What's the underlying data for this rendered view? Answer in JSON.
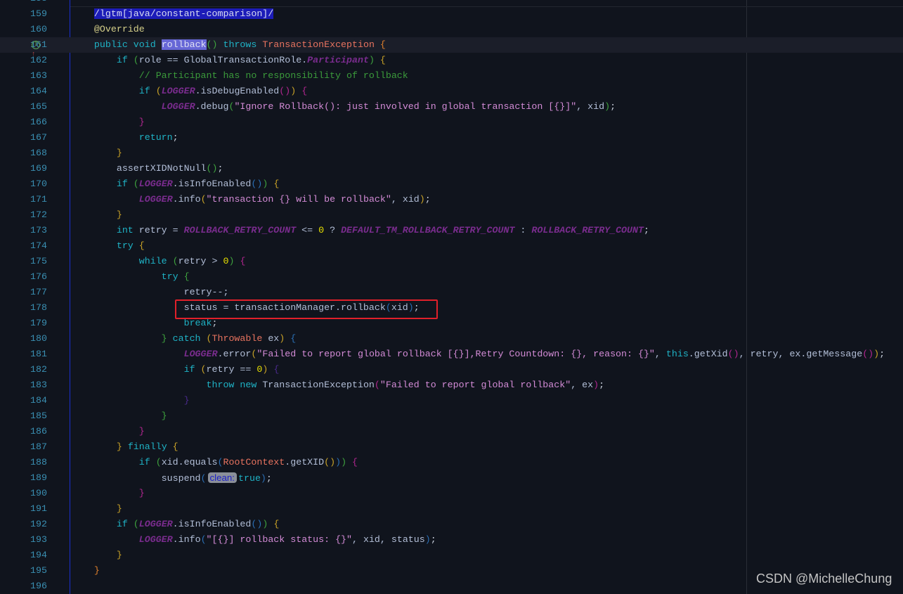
{
  "editor": {
    "first_line_number": 158,
    "current_line": 161,
    "gutter_icon_line": 161,
    "gutter_icon": "implements-override-icon",
    "highlighted_line_box": 178,
    "colors": {
      "background": "#10141d",
      "line_numbers": "#3a8fb2",
      "highlight_box": "#e0202a",
      "keyword": "#1fb3c6",
      "string": "#d38bd6",
      "comment": "#3b9b3b",
      "constant": "#7a2c8e",
      "class": "#e8735f"
    },
    "lines": [
      [],
      [
        [
          "p",
          "    "
        ],
        [
          "sel",
          "/lgtm[java/constant-comparison]/"
        ]
      ],
      [
        [
          "p",
          "    "
        ],
        [
          "a",
          "@Override"
        ]
      ],
      [
        [
          "p",
          "    "
        ],
        [
          "k",
          "public void "
        ],
        [
          "hl",
          "rollback"
        ],
        [
          "bg",
          "()"
        ],
        [
          "p",
          " "
        ],
        [
          "k",
          "throws "
        ],
        [
          "C",
          "TransactionException "
        ],
        [
          "bo",
          "{"
        ]
      ],
      [
        [
          "p",
          "        "
        ],
        [
          "k",
          "if "
        ],
        [
          "bg",
          "("
        ],
        [
          "i",
          "role == GlobalTransactionRole."
        ],
        [
          "K",
          "Participant"
        ],
        [
          "bg",
          ")"
        ],
        [
          "p",
          " "
        ],
        [
          "by",
          "{"
        ]
      ],
      [
        [
          "c",
          "            // Participant has no responsibility of rollback"
        ]
      ],
      [
        [
          "p",
          "            "
        ],
        [
          "k",
          "if "
        ],
        [
          "by",
          "("
        ],
        [
          "K",
          "LOGGER"
        ],
        [
          "i",
          ".isDebugEnabled"
        ],
        [
          "bm",
          "()"
        ],
        [
          "by",
          ")"
        ],
        [
          "p",
          " "
        ],
        [
          "bm",
          "{"
        ]
      ],
      [
        [
          "p",
          "                "
        ],
        [
          "K",
          "LOGGER"
        ],
        [
          "i",
          ".debug"
        ],
        [
          "bg",
          "("
        ],
        [
          "s",
          "\"Ignore Rollback(): just involved in global transaction [{}]\""
        ],
        [
          "i",
          ", xid"
        ],
        [
          "bg",
          ")"
        ],
        [
          "p",
          ";"
        ]
      ],
      [
        [
          "p",
          "            "
        ],
        [
          "bm",
          "}"
        ]
      ],
      [
        [
          "p",
          "            "
        ],
        [
          "k",
          "return"
        ],
        [
          "p",
          ";"
        ]
      ],
      [
        [
          "p",
          "        "
        ],
        [
          "by",
          "}"
        ]
      ],
      [
        [
          "p",
          "        "
        ],
        [
          "i",
          "assertXIDNotNull"
        ],
        [
          "bg",
          "()"
        ],
        [
          "p",
          ";"
        ]
      ],
      [
        [
          "p",
          "        "
        ],
        [
          "k",
          "if "
        ],
        [
          "bg",
          "("
        ],
        [
          "K",
          "LOGGER"
        ],
        [
          "i",
          ".isInfoEnabled"
        ],
        [
          "bb",
          "()"
        ],
        [
          "bg",
          ")"
        ],
        [
          "p",
          " "
        ],
        [
          "by",
          "{"
        ]
      ],
      [
        [
          "p",
          "            "
        ],
        [
          "K",
          "LOGGER"
        ],
        [
          "i",
          ".info"
        ],
        [
          "by",
          "("
        ],
        [
          "s",
          "\"transaction {} will be rollback\""
        ],
        [
          "i",
          ", xid"
        ],
        [
          "by",
          ")"
        ],
        [
          "p",
          ";"
        ]
      ],
      [
        [
          "p",
          "        "
        ],
        [
          "by",
          "}"
        ]
      ],
      [
        [
          "p",
          "        "
        ],
        [
          "k",
          "int "
        ],
        [
          "i",
          "retry = "
        ],
        [
          "K",
          "ROLLBACK_RETRY_COUNT"
        ],
        [
          "i",
          " <= "
        ],
        [
          "n",
          "0"
        ],
        [
          "i",
          " ? "
        ],
        [
          "K",
          "DEFAULT_TM_ROLLBACK_RETRY_COUNT"
        ],
        [
          "i",
          " : "
        ],
        [
          "K",
          "ROLLBACK_RETRY_COUNT"
        ],
        [
          "p",
          ";"
        ]
      ],
      [
        [
          "p",
          "        "
        ],
        [
          "k",
          "try "
        ],
        [
          "by",
          "{"
        ]
      ],
      [
        [
          "p",
          "            "
        ],
        [
          "k",
          "while "
        ],
        [
          "bg",
          "("
        ],
        [
          "i",
          "retry > "
        ],
        [
          "n",
          "0"
        ],
        [
          "bg",
          ")"
        ],
        [
          "p",
          " "
        ],
        [
          "bm",
          "{"
        ]
      ],
      [
        [
          "p",
          "                "
        ],
        [
          "k",
          "try "
        ],
        [
          "bg",
          "{"
        ]
      ],
      [
        [
          "p",
          "                    "
        ],
        [
          "i",
          "retry--;"
        ]
      ],
      [
        [
          "p",
          "                    "
        ],
        [
          "i",
          "status = transactionManager.rollback"
        ],
        [
          "bb",
          "("
        ],
        [
          "i",
          "xid"
        ],
        [
          "bb",
          ")"
        ],
        [
          "p",
          ";"
        ]
      ],
      [
        [
          "p",
          "                    "
        ],
        [
          "k",
          "break"
        ],
        [
          "p",
          ";"
        ]
      ],
      [
        [
          "p",
          "                "
        ],
        [
          "bg",
          "}"
        ],
        [
          "p",
          " "
        ],
        [
          "k",
          "catch "
        ],
        [
          "by",
          "("
        ],
        [
          "C",
          "Throwable "
        ],
        [
          "i",
          "ex"
        ],
        [
          "by",
          ")"
        ],
        [
          "p",
          " "
        ],
        [
          "bb",
          "{"
        ]
      ],
      [
        [
          "p",
          "                    "
        ],
        [
          "K",
          "LOGGER"
        ],
        [
          "i",
          ".error"
        ],
        [
          "by",
          "("
        ],
        [
          "s",
          "\"Failed to report global rollback [{}],Retry Countdown: {}, reason: {}\""
        ],
        [
          "i",
          ", "
        ],
        [
          "k",
          "this"
        ],
        [
          "i",
          ".getXid"
        ],
        [
          "bm",
          "()"
        ],
        [
          "i",
          ", retry, ex.getMessage"
        ],
        [
          "bm",
          "()"
        ],
        [
          "by",
          ")"
        ],
        [
          "p",
          ";"
        ]
      ],
      [
        [
          "p",
          "                    "
        ],
        [
          "k",
          "if "
        ],
        [
          "by",
          "("
        ],
        [
          "i",
          "retry == "
        ],
        [
          "n",
          "0"
        ],
        [
          "by",
          ")"
        ],
        [
          "p",
          " "
        ],
        [
          "bp",
          "{"
        ]
      ],
      [
        [
          "p",
          "                        "
        ],
        [
          "k",
          "throw new "
        ],
        [
          "i",
          "TransactionException"
        ],
        [
          "bm",
          "("
        ],
        [
          "s",
          "\"Failed to report global rollback\""
        ],
        [
          "i",
          ", ex"
        ],
        [
          "bm",
          ")"
        ],
        [
          "p",
          ";"
        ]
      ],
      [
        [
          "p",
          "                    "
        ],
        [
          "bp",
          "}"
        ]
      ],
      [
        [
          "p",
          "                "
        ],
        [
          "bg",
          "}"
        ]
      ],
      [
        [
          "p",
          "            "
        ],
        [
          "bm",
          "}"
        ]
      ],
      [
        [
          "p",
          "        "
        ],
        [
          "by",
          "}"
        ],
        [
          "p",
          " "
        ],
        [
          "k",
          "finally "
        ],
        [
          "by",
          "{"
        ]
      ],
      [
        [
          "p",
          "            "
        ],
        [
          "k",
          "if "
        ],
        [
          "bg",
          "("
        ],
        [
          "i",
          "xid.equals"
        ],
        [
          "bb",
          "("
        ],
        [
          "C",
          "RootContext"
        ],
        [
          "i",
          ".getXID"
        ],
        [
          "by",
          "()"
        ],
        [
          "bb",
          ")"
        ],
        [
          "bg",
          ")"
        ],
        [
          "p",
          " "
        ],
        [
          "bm",
          "{"
        ]
      ],
      [
        [
          "p",
          "                "
        ],
        [
          "i",
          "suspend"
        ],
        [
          "bb",
          "("
        ],
        [
          "h",
          "clean:"
        ],
        [
          "k",
          "true"
        ],
        [
          "bb",
          ")"
        ],
        [
          "p",
          ";"
        ]
      ],
      [
        [
          "p",
          "            "
        ],
        [
          "bm",
          "}"
        ]
      ],
      [
        [
          "p",
          "        "
        ],
        [
          "by",
          "}"
        ]
      ],
      [
        [
          "p",
          "        "
        ],
        [
          "k",
          "if "
        ],
        [
          "bg",
          "("
        ],
        [
          "K",
          "LOGGER"
        ],
        [
          "i",
          ".isInfoEnabled"
        ],
        [
          "bb",
          "()"
        ],
        [
          "bg",
          ")"
        ],
        [
          "p",
          " "
        ],
        [
          "by",
          "{"
        ]
      ],
      [
        [
          "p",
          "            "
        ],
        [
          "K",
          "LOGGER"
        ],
        [
          "i",
          ".info"
        ],
        [
          "bb",
          "("
        ],
        [
          "s",
          "\"[{}] rollback status: {}\""
        ],
        [
          "i",
          ", xid, status"
        ],
        [
          "bb",
          ")"
        ],
        [
          "p",
          ";"
        ]
      ],
      [
        [
          "p",
          "        "
        ],
        [
          "by",
          "}"
        ]
      ],
      [
        [
          "p",
          "    "
        ],
        [
          "bo",
          "}"
        ]
      ],
      []
    ]
  },
  "watermark": "CSDN @MichelleChung"
}
